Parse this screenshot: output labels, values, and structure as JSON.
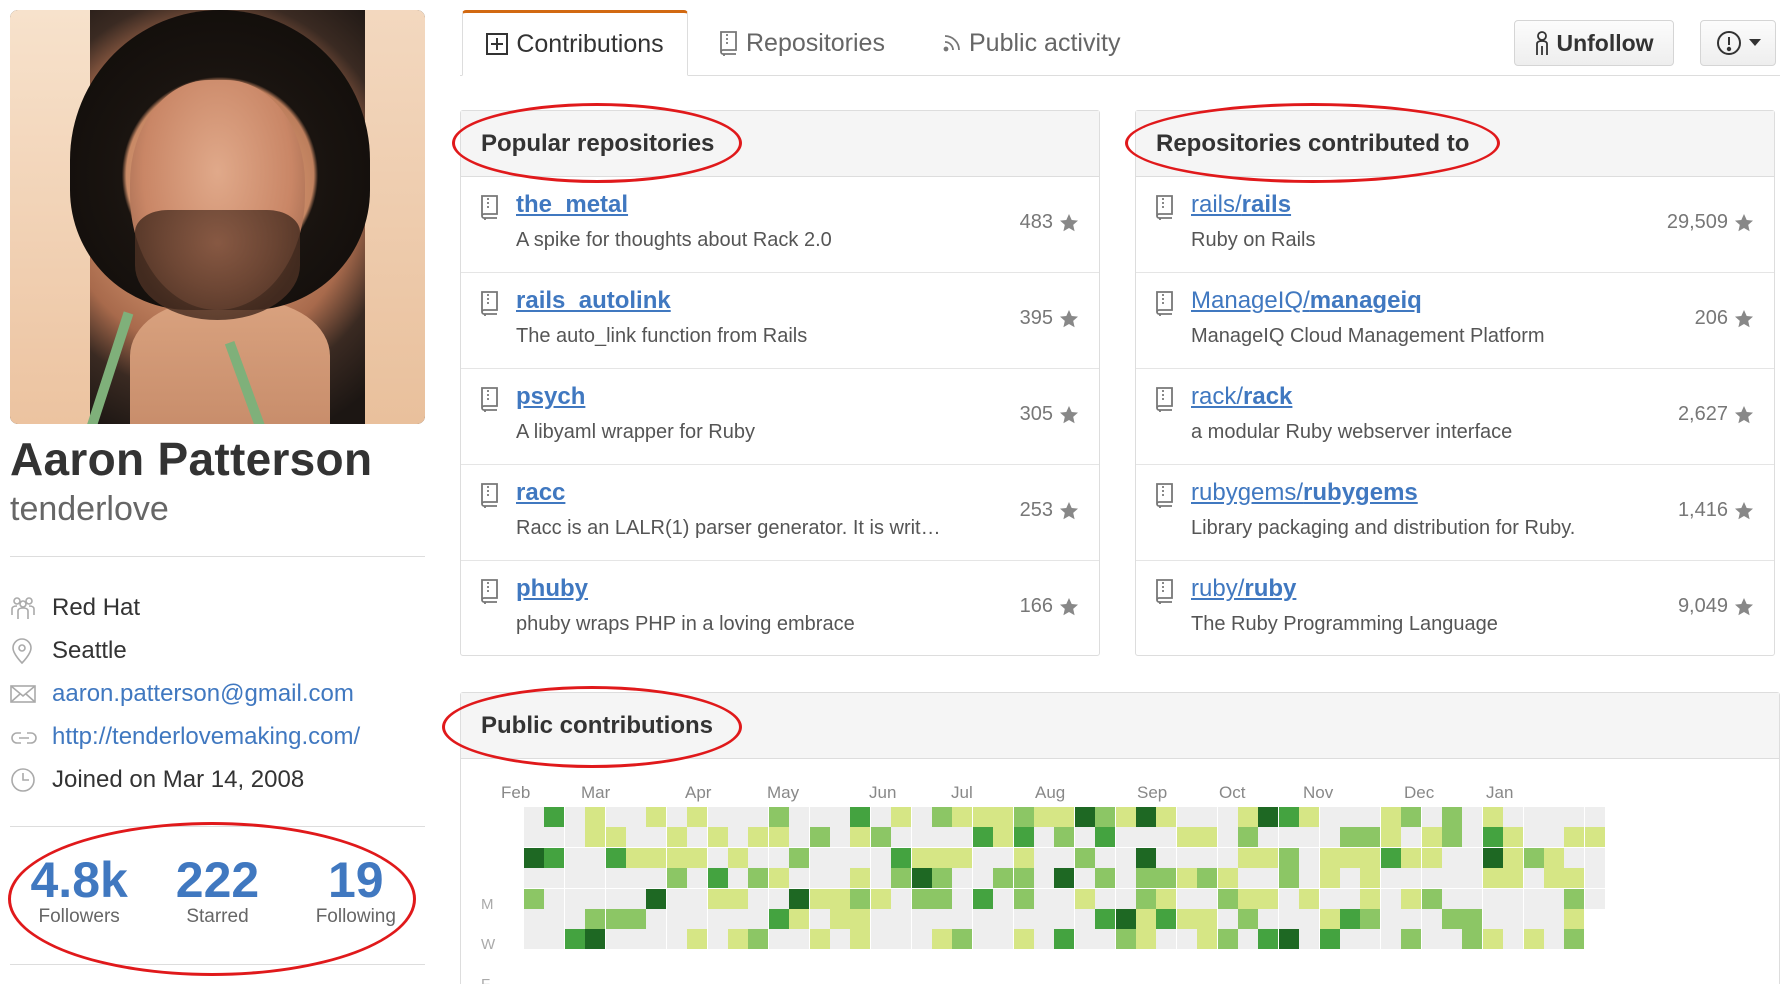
{
  "profile": {
    "fullname": "Aaron Patterson",
    "username": "tenderlove",
    "company": "Red Hat",
    "location": "Seattle",
    "email": "aaron.patterson@gmail.com",
    "website": "http://tenderlovemaking.com/",
    "joined": "Joined on Mar 14, 2008",
    "icons": [
      "organization-icon",
      "location-icon",
      "mail-icon",
      "link-icon",
      "clock-icon"
    ]
  },
  "stats": [
    {
      "value": "4.8k",
      "label": "Followers"
    },
    {
      "value": "222",
      "label": "Starred"
    },
    {
      "value": "19",
      "label": "Following"
    }
  ],
  "tabs": [
    {
      "label": "Contributions",
      "icon": "diff-added-icon"
    },
    {
      "label": "Repositories",
      "icon": "repo-icon"
    },
    {
      "label": "Public activity",
      "icon": "rss-icon"
    }
  ],
  "actions": {
    "unfollow": "Unfollow",
    "more_icon": "alert-icon"
  },
  "popular": {
    "title": "Popular repositories",
    "repos": [
      {
        "name": "the_metal",
        "owner": "",
        "desc": "A spike for thoughts about Rack 2.0",
        "stars": "483"
      },
      {
        "name": "rails_autolink",
        "owner": "",
        "desc": "The auto_link function from Rails",
        "stars": "395"
      },
      {
        "name": "psych",
        "owner": "",
        "desc": "A libyaml wrapper for Ruby",
        "stars": "305"
      },
      {
        "name": "racc",
        "owner": "",
        "desc": "Racc is an LALR(1) parser generator. It is writ…",
        "stars": "253"
      },
      {
        "name": "phuby",
        "owner": "",
        "desc": "phuby wraps PHP in a loving embrace",
        "stars": "166"
      }
    ]
  },
  "contributed": {
    "title": "Repositories contributed to",
    "repos": [
      {
        "owner": "rails/",
        "name": "rails",
        "desc": "Ruby on Rails",
        "stars": "29,509"
      },
      {
        "owner": "ManageIQ/",
        "name": "manageiq",
        "desc": "ManageIQ Cloud Management Platform",
        "stars": "206"
      },
      {
        "owner": "rack/",
        "name": "rack",
        "desc": "a modular Ruby webserver interface",
        "stars": "2,627"
      },
      {
        "owner": "rubygems/",
        "name": "rubygems",
        "desc": "Library packaging and distribution for Ruby.",
        "stars": "1,416"
      },
      {
        "owner": "ruby/",
        "name": "ruby",
        "desc": "The Ruby Programming Language",
        "stars": "9,049"
      }
    ]
  },
  "contributions": {
    "title": "Public contributions",
    "months": [
      "Feb",
      "Mar",
      "Apr",
      "May",
      "Jun",
      "Jul",
      "Aug",
      "Sep",
      "Oct",
      "Nov",
      "Dec",
      "Jan"
    ],
    "day_labels": [
      "M",
      "W",
      "F"
    ],
    "colors": [
      "#eeeeee",
      "#d6e685",
      "#8cc665",
      "#44a340",
      "#1e6823"
    ]
  }
}
